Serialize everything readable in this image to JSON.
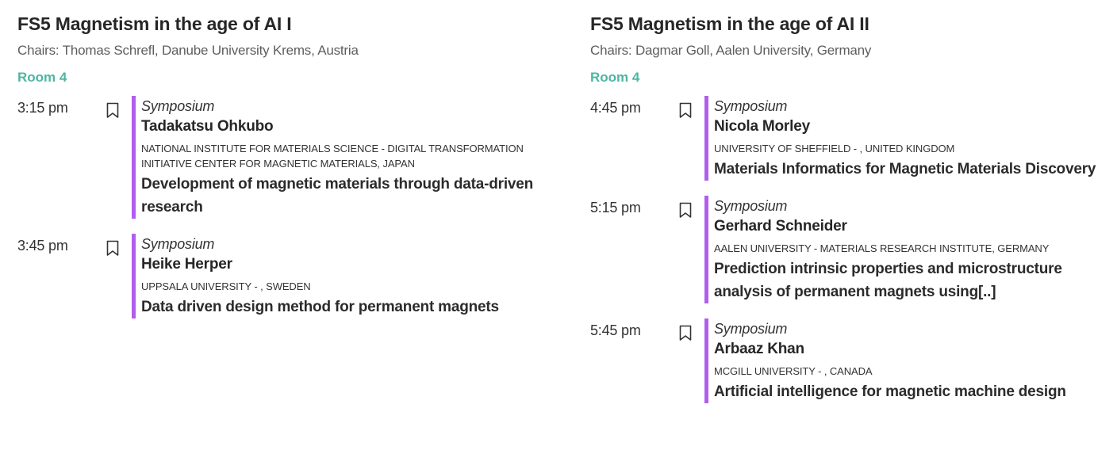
{
  "sessions": [
    {
      "title": "FS5 Magnetism in the age of AI I",
      "chairs": "Chairs: Thomas Schrefl, Danube University Krems, Austria",
      "room": "Room 4",
      "talks": [
        {
          "time": "3:15 pm",
          "kind": "Symposium",
          "speaker": "Tadakatsu Ohkubo",
          "affiliation": "NATIONAL INSTITUTE FOR MATERIALS SCIENCE - DIGITAL TRANSFORMATION INITIATIVE CENTER FOR MAGNETIC MATERIALS, JAPAN",
          "topic": "Development of magnetic materials through data-driven research"
        },
        {
          "time": "3:45 pm",
          "kind": "Symposium",
          "speaker": "Heike Herper",
          "affiliation": "UPPSALA UNIVERSITY - , SWEDEN",
          "topic": "Data driven design method for permanent magnets"
        }
      ]
    },
    {
      "title": "FS5 Magnetism in the age of AI II",
      "chairs": "Chairs: Dagmar Goll, Aalen University, Germany",
      "room": "Room 4",
      "talks": [
        {
          "time": "4:45 pm",
          "kind": "Symposium",
          "speaker": "Nicola Morley",
          "affiliation": "UNIVERSITY OF SHEFFIELD - , UNITED KINGDOM",
          "topic": "Materials Informatics for Magnetic Materials Discovery"
        },
        {
          "time": "5:15 pm",
          "kind": "Symposium",
          "speaker": "Gerhard Schneider",
          "affiliation": "AALEN UNIVERSITY - MATERIALS RESEARCH INSTITUTE, GERMANY",
          "topic": "Prediction intrinsic properties and microstructure analysis of permanent magnets using[..]"
        },
        {
          "time": "5:45 pm",
          "kind": "Symposium",
          "speaker": "Arbaaz Khan",
          "affiliation": "MCGILL UNIVERSITY - , CANADA",
          "topic": "Artificial intelligence for magnetic machine design"
        }
      ]
    }
  ],
  "colors": {
    "accent_bar": "#b25df0",
    "room": "#4fb6a2"
  },
  "icons": {
    "bookmark": "bookmark-icon"
  }
}
